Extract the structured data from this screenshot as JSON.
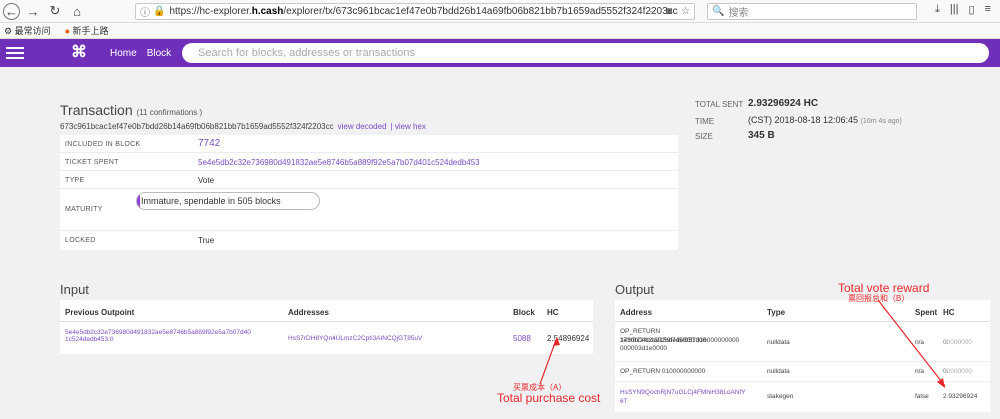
{
  "browser": {
    "url_prefix": "https://hc-explorer.",
    "url_domain": "h.cash",
    "url_path": "/explorer/tx/673c961bcac1ef47e0b7bdd26b14a69fb06b821bb7b1659ad5552f324f2203cc",
    "search_placeholder": "搜索",
    "bookmarks": [
      "最常访问",
      "新手上路"
    ]
  },
  "header": {
    "nav_home": "Home",
    "nav_block": "Block",
    "search_placeholder": "Search for blocks, addresses or transactions"
  },
  "transaction": {
    "title": "Transaction",
    "confirmations": "(11 confirmations )",
    "hash": "673c961bcac1ef47e0b7bdd26b14a69fb06b821bb7b1659ad5552f324f2203cc",
    "view_decoded": "view decoded",
    "view_hex": "| view hex",
    "rows": [
      {
        "label": "INCLUDED IN BLOCK",
        "value": "7742"
      },
      {
        "label": "TICKET SPENT",
        "value": "5e4e5db2c32e736980d491832ae5e8746b5a889f92e5a7b07d401c524dedb453"
      },
      {
        "label": "TYPE",
        "value": "Vote"
      },
      {
        "label": "MATURITY",
        "value": "Immature, spendable in 505 blocks"
      },
      {
        "label": "LOCKED",
        "value": "True"
      }
    ]
  },
  "summary": {
    "total_sent_label": "TOTAL SENT",
    "total_sent_value": "2.93296924 HC",
    "time_label": "TIME",
    "time_value": "(CST) 2018-08-18 12:06:45",
    "time_ago": "(16m 4s ago)",
    "size_label": "SIZE",
    "size_value": "345 B"
  },
  "input": {
    "title": "Input",
    "headers": [
      "Previous Outpoint",
      "Addresses",
      "Block",
      "HC"
    ],
    "rows": [
      {
        "outpoint_1": "5e4e5db2c32e736980d491832ae5e8746b5a889f92e5a7b07d40",
        "outpoint_2": "1c524dedb453:0",
        "address": "HsS7rDH8YQn4ULmzC2Cpti3AINCQjGT85uV",
        "block": "5088",
        "hc": "2.54896924"
      }
    ]
  },
  "output": {
    "title": "Output",
    "headers": [
      "Address",
      "Type",
      "Spent",
      "HC"
    ],
    "rows": [
      {
        "addr_1": "OP_RETURN 1e30b04c2ad159f745f051d06",
        "addr_2": "37bf0224b1592bdede80f731b000000000",
        "addr_3": "000003d1e0000",
        "type": "nulldata",
        "spent": "n/a",
        "hc_int": "0.",
        "hc_frac": "00000000"
      },
      {
        "addr_1": "OP_RETURN 010000000000",
        "type": "nulldata",
        "spent": "n/a",
        "hc_int": "0.",
        "hc_frac": "00000000"
      },
      {
        "addr_1": "HsSYN9QochRjN7uGLCj4FMhiH38LoANfY",
        "addr_2": "6T",
        "type": "stakegen",
        "spent": "false",
        "hc_int": "2.93296924",
        "hc_frac": ""
      }
    ]
  },
  "annotations": {
    "reward_en": "Total vote reward",
    "reward_cn": "票回报总和（B）",
    "cost_cn": "买票成本（A）",
    "cost_en": "Total purchase cost"
  },
  "colors": {
    "brand": "#6f2fb8",
    "link": "#7a4cc2",
    "annotation": "#e8282b"
  }
}
